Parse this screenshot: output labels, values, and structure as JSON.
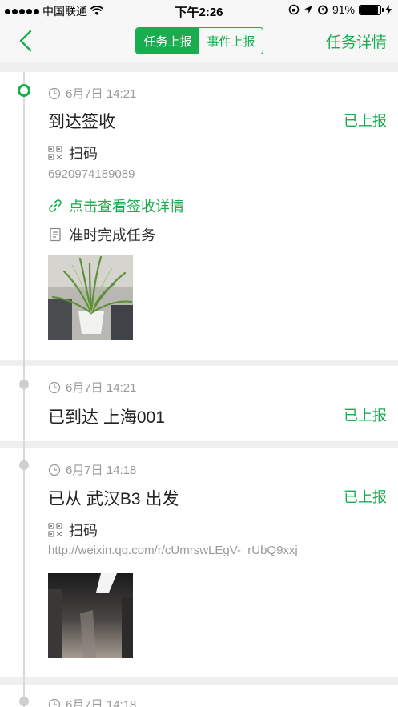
{
  "status_bar": {
    "carrier": "中国联通",
    "time": "下午2:26",
    "battery_percent": "91%",
    "battery_level": 0.91
  },
  "nav": {
    "segments": [
      "任务上报",
      "事件上报"
    ],
    "active_segment": 0,
    "right_action": "任务详情"
  },
  "entries": [
    {
      "time": "6月7日 14:21",
      "title": "到达签收",
      "status": "已上报",
      "scan_label": "扫码",
      "scan_value": "6920974189089",
      "link_text": "点击查看签收详情",
      "note": "准时完成任务",
      "photo": "plant-photo"
    },
    {
      "time": "6月7日 14:21",
      "title": "已到达 上海001",
      "status": "已上报"
    },
    {
      "time": "6月7日 14:18",
      "title": "已从 武汉B3 出发",
      "status": "已上报",
      "scan_label": "扫码",
      "scan_value": "http://weixin.qq.com/r/cUmrswLEgV-_rUbQ9xxj",
      "photo": "dark-room-photo"
    },
    {
      "time": "6月7日 14:18"
    }
  ],
  "colors": {
    "accent": "#1aad4f",
    "muted_text": "#999999",
    "background": "#efefef"
  }
}
